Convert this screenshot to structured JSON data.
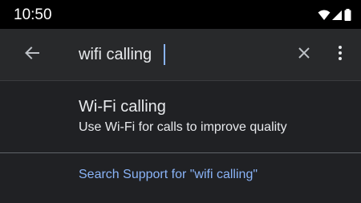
{
  "status_bar": {
    "time": "10:50",
    "icons": [
      "wifi-icon",
      "cell-signal-icon",
      "battery-icon"
    ]
  },
  "search": {
    "value": "wifi calling",
    "back_icon": "arrow-back-icon",
    "clear_icon": "close-icon",
    "more_icon": "more-vert-icon"
  },
  "results": [
    {
      "title": "Wi-Fi calling",
      "subtitle": "Use Wi-Fi for calls to improve quality"
    }
  ],
  "support_link": {
    "label": "Search Support for \"wifi calling\""
  },
  "colors": {
    "background": "#202124",
    "search_bar": "#28292b",
    "text_primary": "#e8eaed",
    "accent": "#8ab4f8",
    "status_bar": "#000000"
  }
}
